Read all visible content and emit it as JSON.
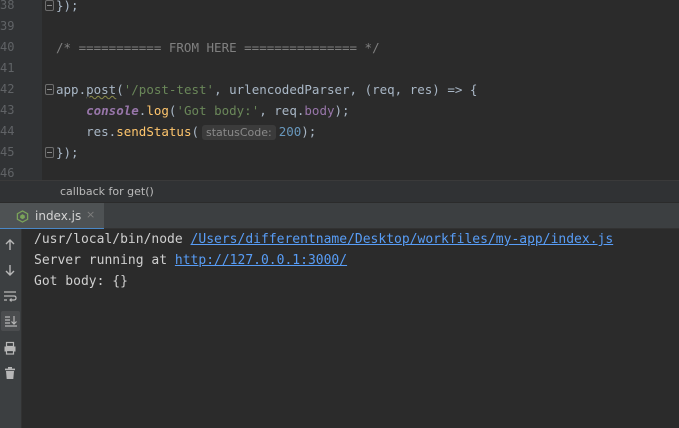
{
  "editor": {
    "lines": [
      {
        "num": "38",
        "tokens": [
          {
            "t": "});",
            "c": "t-punc"
          }
        ]
      },
      {
        "num": "39",
        "tokens": []
      },
      {
        "num": "40",
        "tokens": [
          {
            "t": "/* =========== FROM HERE =============== */",
            "c": "t-cmt"
          }
        ]
      },
      {
        "num": "41",
        "tokens": []
      },
      {
        "num": "42",
        "tokens": [
          {
            "t": "app",
            "c": "t-punc"
          },
          {
            "t": ".",
            "c": "t-punc"
          },
          {
            "t": "post",
            "c": "t-punc t-squig"
          },
          {
            "t": "(",
            "c": "t-punc"
          },
          {
            "t": "'/post-test'",
            "c": "t-str"
          },
          {
            "t": ", urlencodedParser, (req, res) => {",
            "c": "t-punc"
          }
        ]
      },
      {
        "num": "43",
        "tokens": [
          {
            "t": "    ",
            "c": "t-punc"
          },
          {
            "t": "console",
            "c": "t-con"
          },
          {
            "t": ".",
            "c": "t-punc"
          },
          {
            "t": "log",
            "c": "t-fn"
          },
          {
            "t": "(",
            "c": "t-punc"
          },
          {
            "t": "'Got body:'",
            "c": "t-str"
          },
          {
            "t": ", req.",
            "c": "t-punc"
          },
          {
            "t": "body",
            "c": "t-prop"
          },
          {
            "t": ");",
            "c": "t-punc"
          }
        ]
      },
      {
        "num": "44",
        "tokens": [
          {
            "t": "    res.",
            "c": "t-punc"
          },
          {
            "t": "sendStatus",
            "c": "t-fn"
          },
          {
            "t": "(",
            "c": "t-punc"
          },
          {
            "t": "statusCode:",
            "c": "hint"
          },
          {
            "t": "200",
            "c": "t-num"
          },
          {
            "t": ");",
            "c": "t-punc"
          }
        ]
      },
      {
        "num": "45",
        "tokens": [
          {
            "t": "});",
            "c": "t-punc"
          }
        ]
      },
      {
        "num": "46",
        "tokens": []
      }
    ],
    "fold_markers": [
      "38",
      "42",
      "45"
    ]
  },
  "breadcrumb": {
    "text": "callback for get()"
  },
  "run_panel": {
    "tab": {
      "label": "index.js",
      "close": "×",
      "icon": "nodejs-icon"
    },
    "tools": [
      {
        "name": "scroll-up-icon",
        "active": false
      },
      {
        "name": "scroll-down-icon",
        "active": false
      },
      {
        "name": "soft-wrap-icon",
        "active": false
      },
      {
        "name": "scroll-to-end-icon",
        "active": true
      },
      {
        "name": "print-icon",
        "active": false
      },
      {
        "name": "trash-icon",
        "active": false
      }
    ],
    "output": [
      {
        "prefix": "/usr/local/bin/node ",
        "link": "/Users/differentname/Desktop/workfiles/my-app/index.js"
      },
      {
        "prefix": "Server running at ",
        "link": "http://127.0.0.1:3000/"
      },
      {
        "prefix": "Got body: {}",
        "link": ""
      }
    ]
  },
  "colors": {
    "editor_bg": "#2b2b2b",
    "link": "#589df6",
    "tab_underline": "#4a88c7"
  }
}
